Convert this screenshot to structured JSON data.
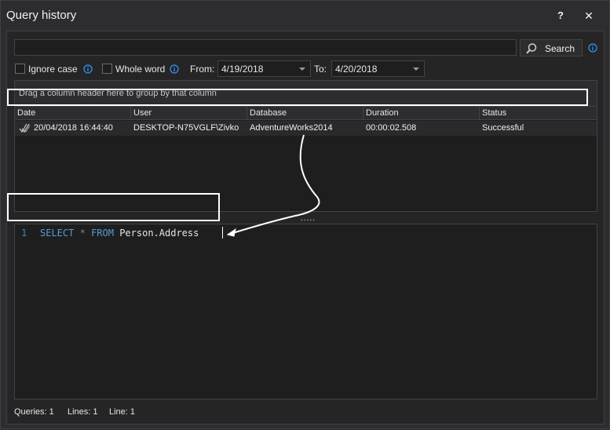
{
  "window": {
    "title": "Query history",
    "help_label": "?",
    "close_label": "✕"
  },
  "search": {
    "value": "",
    "placeholder": "",
    "button_label": "Search",
    "search_icon": "magnifier-icon",
    "info_icon": "info-icon"
  },
  "options": {
    "ignore_case_label": "Ignore case",
    "ignore_case_checked": false,
    "whole_word_label": "Whole word",
    "whole_word_checked": false,
    "from_label": "From:",
    "from_value": "4/19/2018",
    "to_label": "To:",
    "to_value": "4/20/2018"
  },
  "grid": {
    "group_hint": "Drag a column header here to group by that column",
    "columns": [
      "Date",
      "User",
      "Database",
      "Duration",
      "Status"
    ],
    "rows": [
      {
        "status_icon": "success-check-icon",
        "date": "20/04/2018 16:44:40",
        "user": "DESKTOP-N75VGLF\\Zivko",
        "database": "AdventureWorks2014",
        "duration": "00:00:02.508",
        "status": "Successful"
      }
    ]
  },
  "editor": {
    "line_number": "1",
    "code": {
      "kw1": "SELECT",
      "star": "*",
      "kw2": "FROM",
      "object": "Person.Address"
    }
  },
  "statusbar": {
    "queries": "Queries: 1",
    "lines": "Lines: 1",
    "line": "Line: 1"
  },
  "colors": {
    "background": "#2d2d30",
    "panel": "#1e1e1e",
    "keyword": "#569cd6",
    "line_number": "#2b91af",
    "highlight": "#ffffff"
  }
}
